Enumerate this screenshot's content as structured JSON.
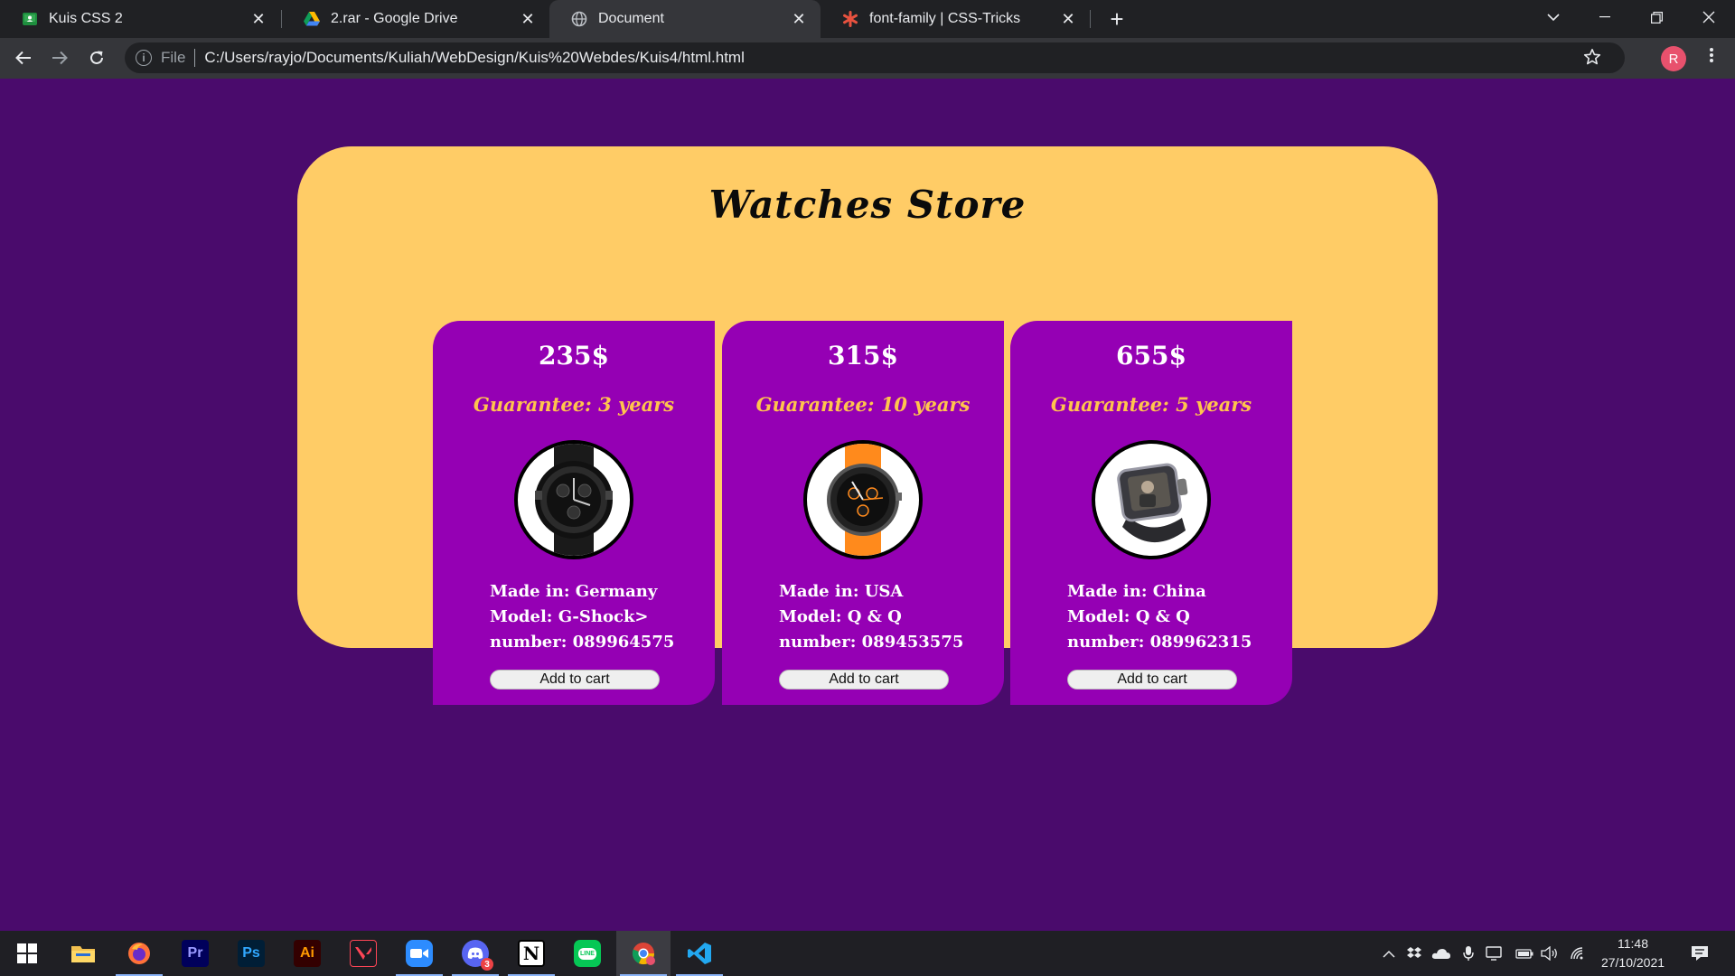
{
  "browser": {
    "tabs": [
      {
        "title": "Kuis CSS 2",
        "favicon": "google-classroom-icon",
        "active": false
      },
      {
        "title": "2.rar - Google Drive",
        "favicon": "google-drive-icon",
        "active": false
      },
      {
        "title": "Document",
        "favicon": "globe-icon",
        "active": true
      },
      {
        "title": "font-family | CSS-Tricks",
        "favicon": "css-tricks-star-icon",
        "active": false
      }
    ],
    "close_glyph": "✕",
    "new_tab_glyph": "+",
    "omnibox": {
      "scheme_label": "File",
      "url": "C:/Users/rayjo/Documents/Kuliah/WebDesign/Kuis%20Webdes/Kuis4/html.html"
    },
    "profile_initial": "R"
  },
  "page": {
    "background": "#4a0b6c",
    "store": {
      "title": "Watches Store",
      "panel_color": "#ffcc66",
      "card_color": "#9500b4",
      "guarantee_color": "#ffc44d",
      "products": [
        {
          "price": "235$",
          "guarantee": "Guarantee: 3 years",
          "made_in": "Made in: Germany",
          "model": "Model: G-Shock>",
          "number": "number: 089964575",
          "button": "Add to cart",
          "strap_color": "#1a1a1a",
          "image": "black-sport-watch-photo"
        },
        {
          "price": "315$",
          "guarantee": "Guarantee: 10 years",
          "made_in": "Made in: USA",
          "model": "Model: Q & Q",
          "number": "number: 089453575",
          "button": "Add to cart",
          "strap_color": "#ff8a1c",
          "image": "orange-strap-watch-photo"
        },
        {
          "price": "655$",
          "guarantee": "Guarantee: 5 years",
          "made_in": "Made in: China",
          "model": "Model: Q & Q",
          "number": "number: 089962315",
          "button": "Add to cart",
          "strap_color": "#2a2a2e",
          "image": "rectangular-photo-watch-photo"
        }
      ]
    }
  },
  "taskbar": {
    "apps": [
      {
        "name": "file-explorer",
        "label": "",
        "color": "#f2c04f"
      },
      {
        "name": "firefox",
        "label": "",
        "color": "#ff7139"
      },
      {
        "name": "premiere-pro",
        "label": "Pr",
        "color": "#9999ff"
      },
      {
        "name": "photoshop",
        "label": "Ps",
        "color": "#31a8ff"
      },
      {
        "name": "illustrator",
        "label": "Ai",
        "color": "#ff9a00"
      },
      {
        "name": "valorant",
        "label": "V",
        "color": "#fd4556"
      },
      {
        "name": "zoom",
        "label": "",
        "color": "#2d8cff"
      },
      {
        "name": "discord",
        "label": "3",
        "color": "#5865f2"
      },
      {
        "name": "notion",
        "label": "N",
        "color": "#ffffff"
      },
      {
        "name": "line",
        "label": "LINE",
        "color": "#06c755"
      },
      {
        "name": "chrome",
        "label": "",
        "color": "#4285f4"
      },
      {
        "name": "vs-code",
        "label": "",
        "color": "#22a8f1"
      }
    ],
    "clock": {
      "time": "11:48",
      "date": "27/10/2021"
    }
  }
}
